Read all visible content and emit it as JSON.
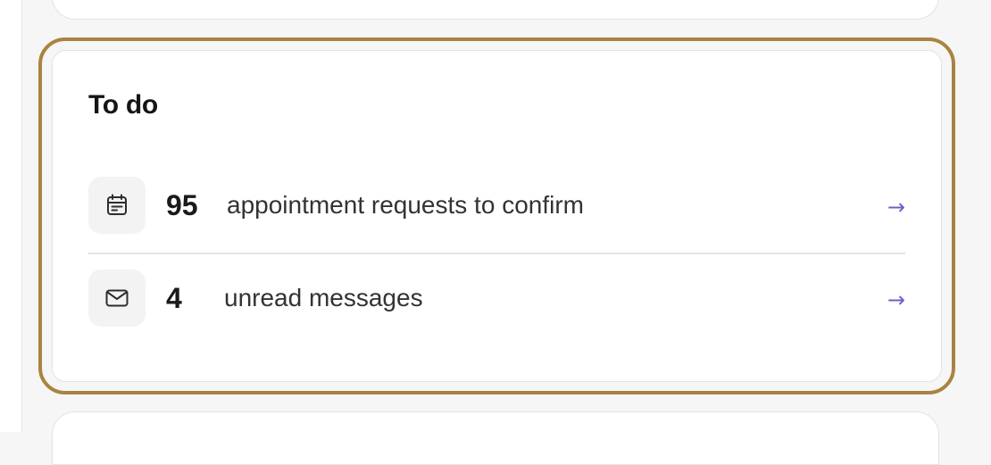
{
  "todo": {
    "title": "To do",
    "items": [
      {
        "icon": "calendar-icon",
        "count": "95",
        "label": "appointment requests to confirm",
        "arrow": "→"
      },
      {
        "icon": "envelope-icon",
        "count": "4",
        "label": "unread messages",
        "arrow": "→"
      }
    ]
  },
  "colors": {
    "highlight_border": "#a8843f",
    "arrow": "#6b62c7",
    "icon_bg": "#f3f3f3"
  }
}
